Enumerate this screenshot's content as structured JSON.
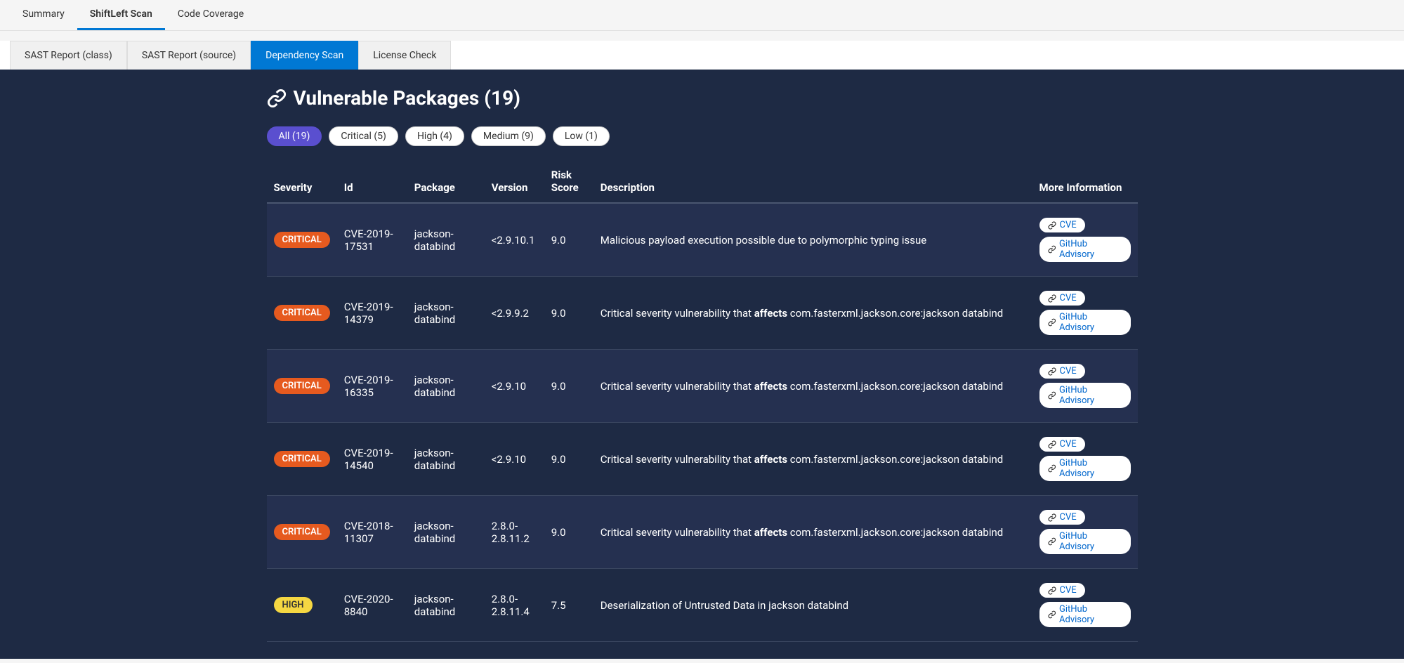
{
  "topTabs": [
    {
      "label": "Summary",
      "active": false
    },
    {
      "label": "ShiftLeft Scan",
      "active": true
    },
    {
      "label": "Code Coverage",
      "active": false
    }
  ],
  "subTabs": [
    {
      "label": "SAST Report (class)",
      "active": false
    },
    {
      "label": "SAST Report (source)",
      "active": false
    },
    {
      "label": "Dependency Scan",
      "active": true
    },
    {
      "label": "License Check",
      "active": false
    }
  ],
  "pageTitle": "Vulnerable Packages (19)",
  "filters": [
    {
      "label": "All (19)",
      "active": true
    },
    {
      "label": "Critical (5)",
      "active": false
    },
    {
      "label": "High (4)",
      "active": false
    },
    {
      "label": "Medium (9)",
      "active": false
    },
    {
      "label": "Low (1)",
      "active": false
    }
  ],
  "columns": [
    "Severity",
    "Id",
    "Package",
    "Version",
    "Risk Score",
    "Description",
    "More Information"
  ],
  "linkLabels": {
    "cve": "CVE",
    "ghsa": "GitHub Advisory"
  },
  "rows": [
    {
      "severity": "CRITICAL",
      "id": "CVE-2019-17531",
      "package": "jackson-databind",
      "version": "<2.9.10.1",
      "risk": "9.0",
      "descPre": "Malicious payload execution possible due to polymorphic typing issue",
      "descBold": "",
      "descPost": ""
    },
    {
      "severity": "CRITICAL",
      "id": "CVE-2019-14379",
      "package": "jackson-databind",
      "version": "<2.9.9.2",
      "risk": "9.0",
      "descPre": "Critical severity vulnerability that ",
      "descBold": "affects",
      "descPost": " com.fasterxml.jackson.core:jackson databind"
    },
    {
      "severity": "CRITICAL",
      "id": "CVE-2019-16335",
      "package": "jackson-databind",
      "version": "<2.9.10",
      "risk": "9.0",
      "descPre": "Critical severity vulnerability that ",
      "descBold": "affects",
      "descPost": " com.fasterxml.jackson.core:jackson databind"
    },
    {
      "severity": "CRITICAL",
      "id": "CVE-2019-14540",
      "package": "jackson-databind",
      "version": "<2.9.10",
      "risk": "9.0",
      "descPre": "Critical severity vulnerability that ",
      "descBold": "affects",
      "descPost": " com.fasterxml.jackson.core:jackson databind"
    },
    {
      "severity": "CRITICAL",
      "id": "CVE-2018-11307",
      "package": "jackson-databind",
      "version": "2.8.0-2.8.11.2",
      "risk": "9.0",
      "descPre": "Critical severity vulnerability that ",
      "descBold": "affects",
      "descPost": " com.fasterxml.jackson.core:jackson databind"
    },
    {
      "severity": "HIGH",
      "id": "CVE-2020-8840",
      "package": "jackson-databind",
      "version": "2.8.0-2.8.11.4",
      "risk": "7.5",
      "descPre": "Deserialization of Untrusted Data in jackson databind",
      "descBold": "",
      "descPost": ""
    }
  ]
}
